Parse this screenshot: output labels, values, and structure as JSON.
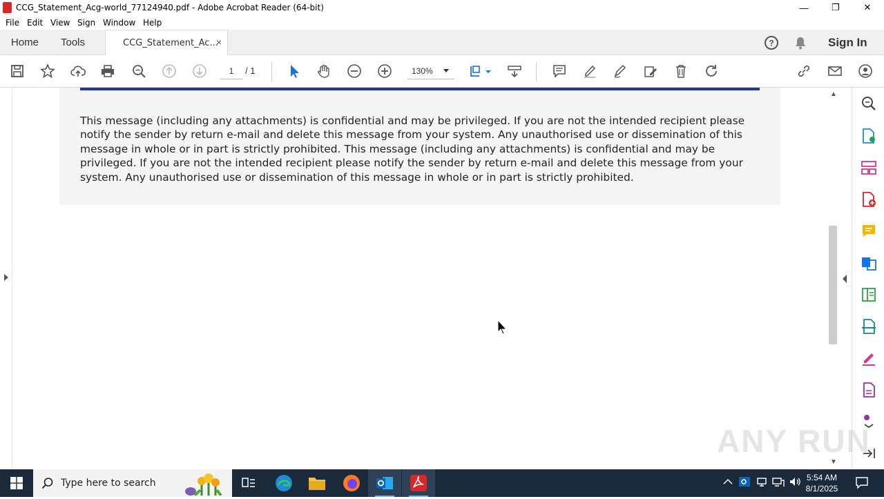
{
  "window": {
    "title": "CCG_Statement_Acg-world_77124940.pdf - Adobe Acrobat Reader (64-bit)",
    "minimize": "—",
    "maximize": "❐",
    "close": "✕"
  },
  "menu": [
    "File",
    "Edit",
    "View",
    "Sign",
    "Window",
    "Help"
  ],
  "tabs": {
    "home": "Home",
    "tools": "Tools",
    "document": "CCG_Statement_Ac...",
    "close": "×",
    "sign_in": "Sign In"
  },
  "toolbar": {
    "page_current": "1",
    "page_total": "/ 1",
    "zoom": "130%"
  },
  "document": {
    "disclaimer": "This message (including any attachments) is confidential and may be privileged. If you are not the intended recipient please notify the sender by return e-mail and delete this message from your system. Any unauthorised use or dissemination of this message in whole or in part is strictly prohibited. This message (including any attachments) is confidential and may be privileged. If you are not the intended recipient please notify the sender by return e-mail and delete this message from your system. Any unauthorised use or dissemination of this message in whole or in part is strictly prohibited."
  },
  "watermark": "ANY RUN",
  "taskbar": {
    "search_placeholder": "Type here to search",
    "time": "5:54 AM",
    "date": "8/1/2025"
  },
  "colors": {
    "accent_blue": "#1473e6",
    "acrobat_red": "#d7282a",
    "rule_blue": "#203b8c",
    "taskbar": "#1b2a3a"
  }
}
